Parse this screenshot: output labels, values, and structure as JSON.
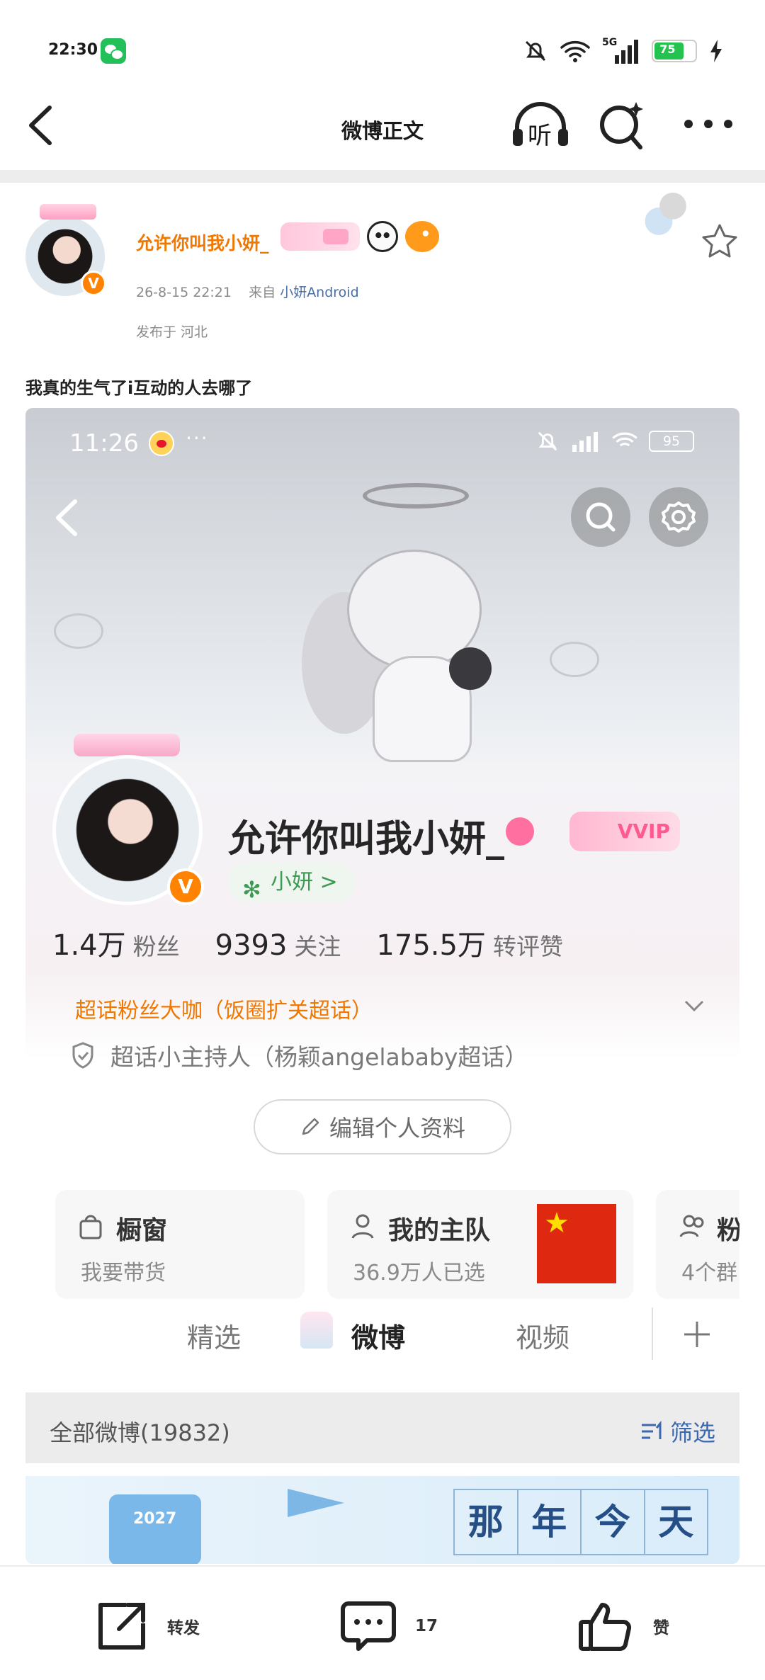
{
  "status_bar": {
    "time": "22:30",
    "network": "5G",
    "battery": "75"
  },
  "nav": {
    "title": "微博正文",
    "listen_label": "听"
  },
  "post": {
    "username": "允许你叫我小妍_",
    "date": "26-8-15 22:21",
    "from_prefix": "来自",
    "source": "小妍Android",
    "location": "发布于 河北",
    "text": "我真的生气了i互动的人去哪了"
  },
  "embedded": {
    "status": {
      "time": "11:26",
      "dots": "···",
      "battery": "95"
    },
    "profile": {
      "name": "允许你叫我小妍_",
      "vvip": "VVIP",
      "chip": "小妍 >",
      "stats": [
        {
          "value": "1.4万",
          "label": "粉丝"
        },
        {
          "value": "9393",
          "label": "关注"
        },
        {
          "value": "175.5万",
          "label": "转评赞"
        }
      ],
      "super_fan": "超话粉丝大咖（饭圈扩关超话）",
      "host": "超话小主持人（杨颖angelababy超话）",
      "edit_button": "编辑个人资料"
    },
    "cards": [
      {
        "title": "橱窗",
        "sub": "我要带货"
      },
      {
        "title": "我的主队",
        "sub": "36.9万人已选"
      },
      {
        "title": "粉",
        "sub": "4个群"
      }
    ],
    "tabs": [
      "精选",
      "微博",
      "视频"
    ],
    "filter": {
      "left": "全部微博(19832)",
      "right": "筛选"
    },
    "banner": {
      "calendar_year": "2027",
      "chars": [
        "那",
        "年",
        "今",
        "天"
      ]
    }
  },
  "bottom_bar": {
    "repost": "转发",
    "comment_count": "17",
    "like": "赞"
  }
}
